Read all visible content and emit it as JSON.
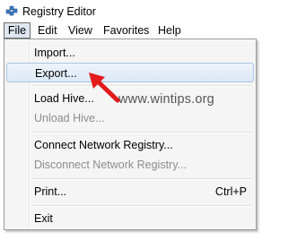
{
  "window": {
    "title": "Registry Editor",
    "icon": "registry-editor-icon"
  },
  "menubar": {
    "items": [
      "File",
      "Edit",
      "View",
      "Favorites",
      "Help"
    ],
    "active_item": "File"
  },
  "file_menu": {
    "items": [
      {
        "label": "Import...",
        "enabled": true
      },
      {
        "label": "Export...",
        "enabled": true,
        "highlighted": true
      },
      {
        "label": "Load Hive...",
        "enabled": true
      },
      {
        "label": "Unload Hive...",
        "enabled": false
      },
      {
        "label": "Connect Network Registry...",
        "enabled": true
      },
      {
        "label": "Disconnect Network Registry...",
        "enabled": false
      },
      {
        "label": "Print...",
        "enabled": true,
        "shortcut": "Ctrl+P"
      },
      {
        "label": "Exit",
        "enabled": true
      }
    ]
  },
  "watermark": {
    "text": "www.wintips.org"
  },
  "annotation": {
    "icon": "red-arrow-icon",
    "color": "#e21b1b"
  }
}
